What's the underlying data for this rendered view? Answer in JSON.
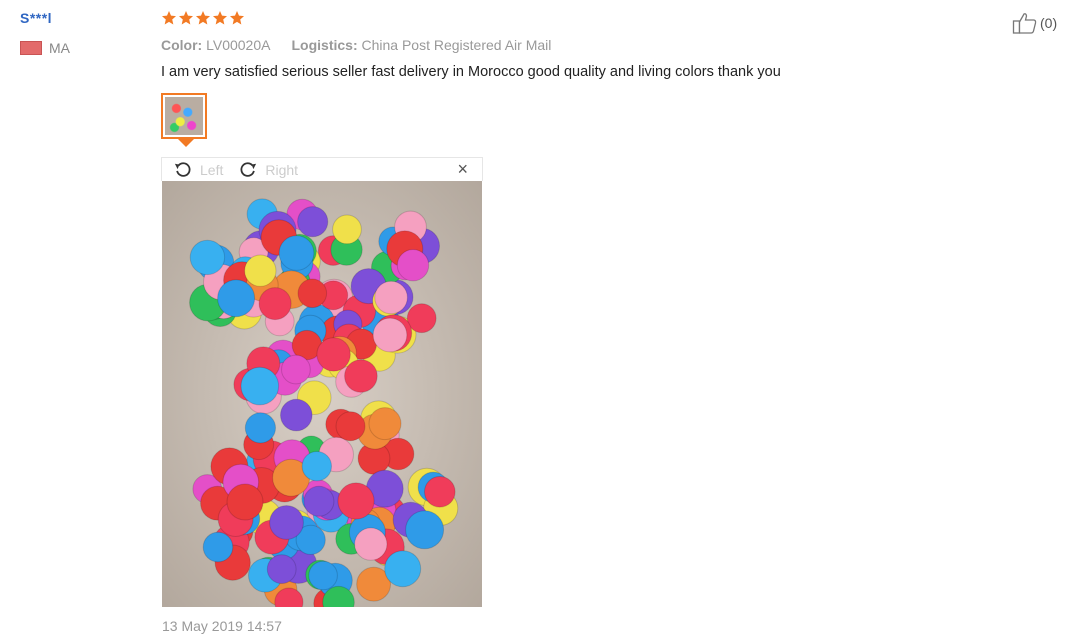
{
  "reviewer": {
    "name": "S***l",
    "country_code": "MA",
    "flag_color": "#e36b6b"
  },
  "rating": {
    "stars": 5,
    "max": 5,
    "color": "#f27a24"
  },
  "meta": {
    "color_label": "Color:",
    "color_value": "LV00020A",
    "logistics_label": "Logistics:",
    "logistics_value": "China Post Registered Air Mail"
  },
  "review": {
    "text": "I am very satisfied serious seller fast delivery in Morocco good quality and living colors thank you",
    "date": "13 May 2019 14:57"
  },
  "viewer": {
    "rotate_left_label": "Left",
    "rotate_right_label": "Right",
    "close_glyph": "×",
    "icons": [
      "rotate-left-icon",
      "rotate-right-icon",
      "close-icon"
    ]
  },
  "helpful": {
    "count_text": "(0)",
    "icon": "thumbs-up-icon"
  },
  "accent_color": "#f27a24",
  "link_color": "#2f66c2"
}
